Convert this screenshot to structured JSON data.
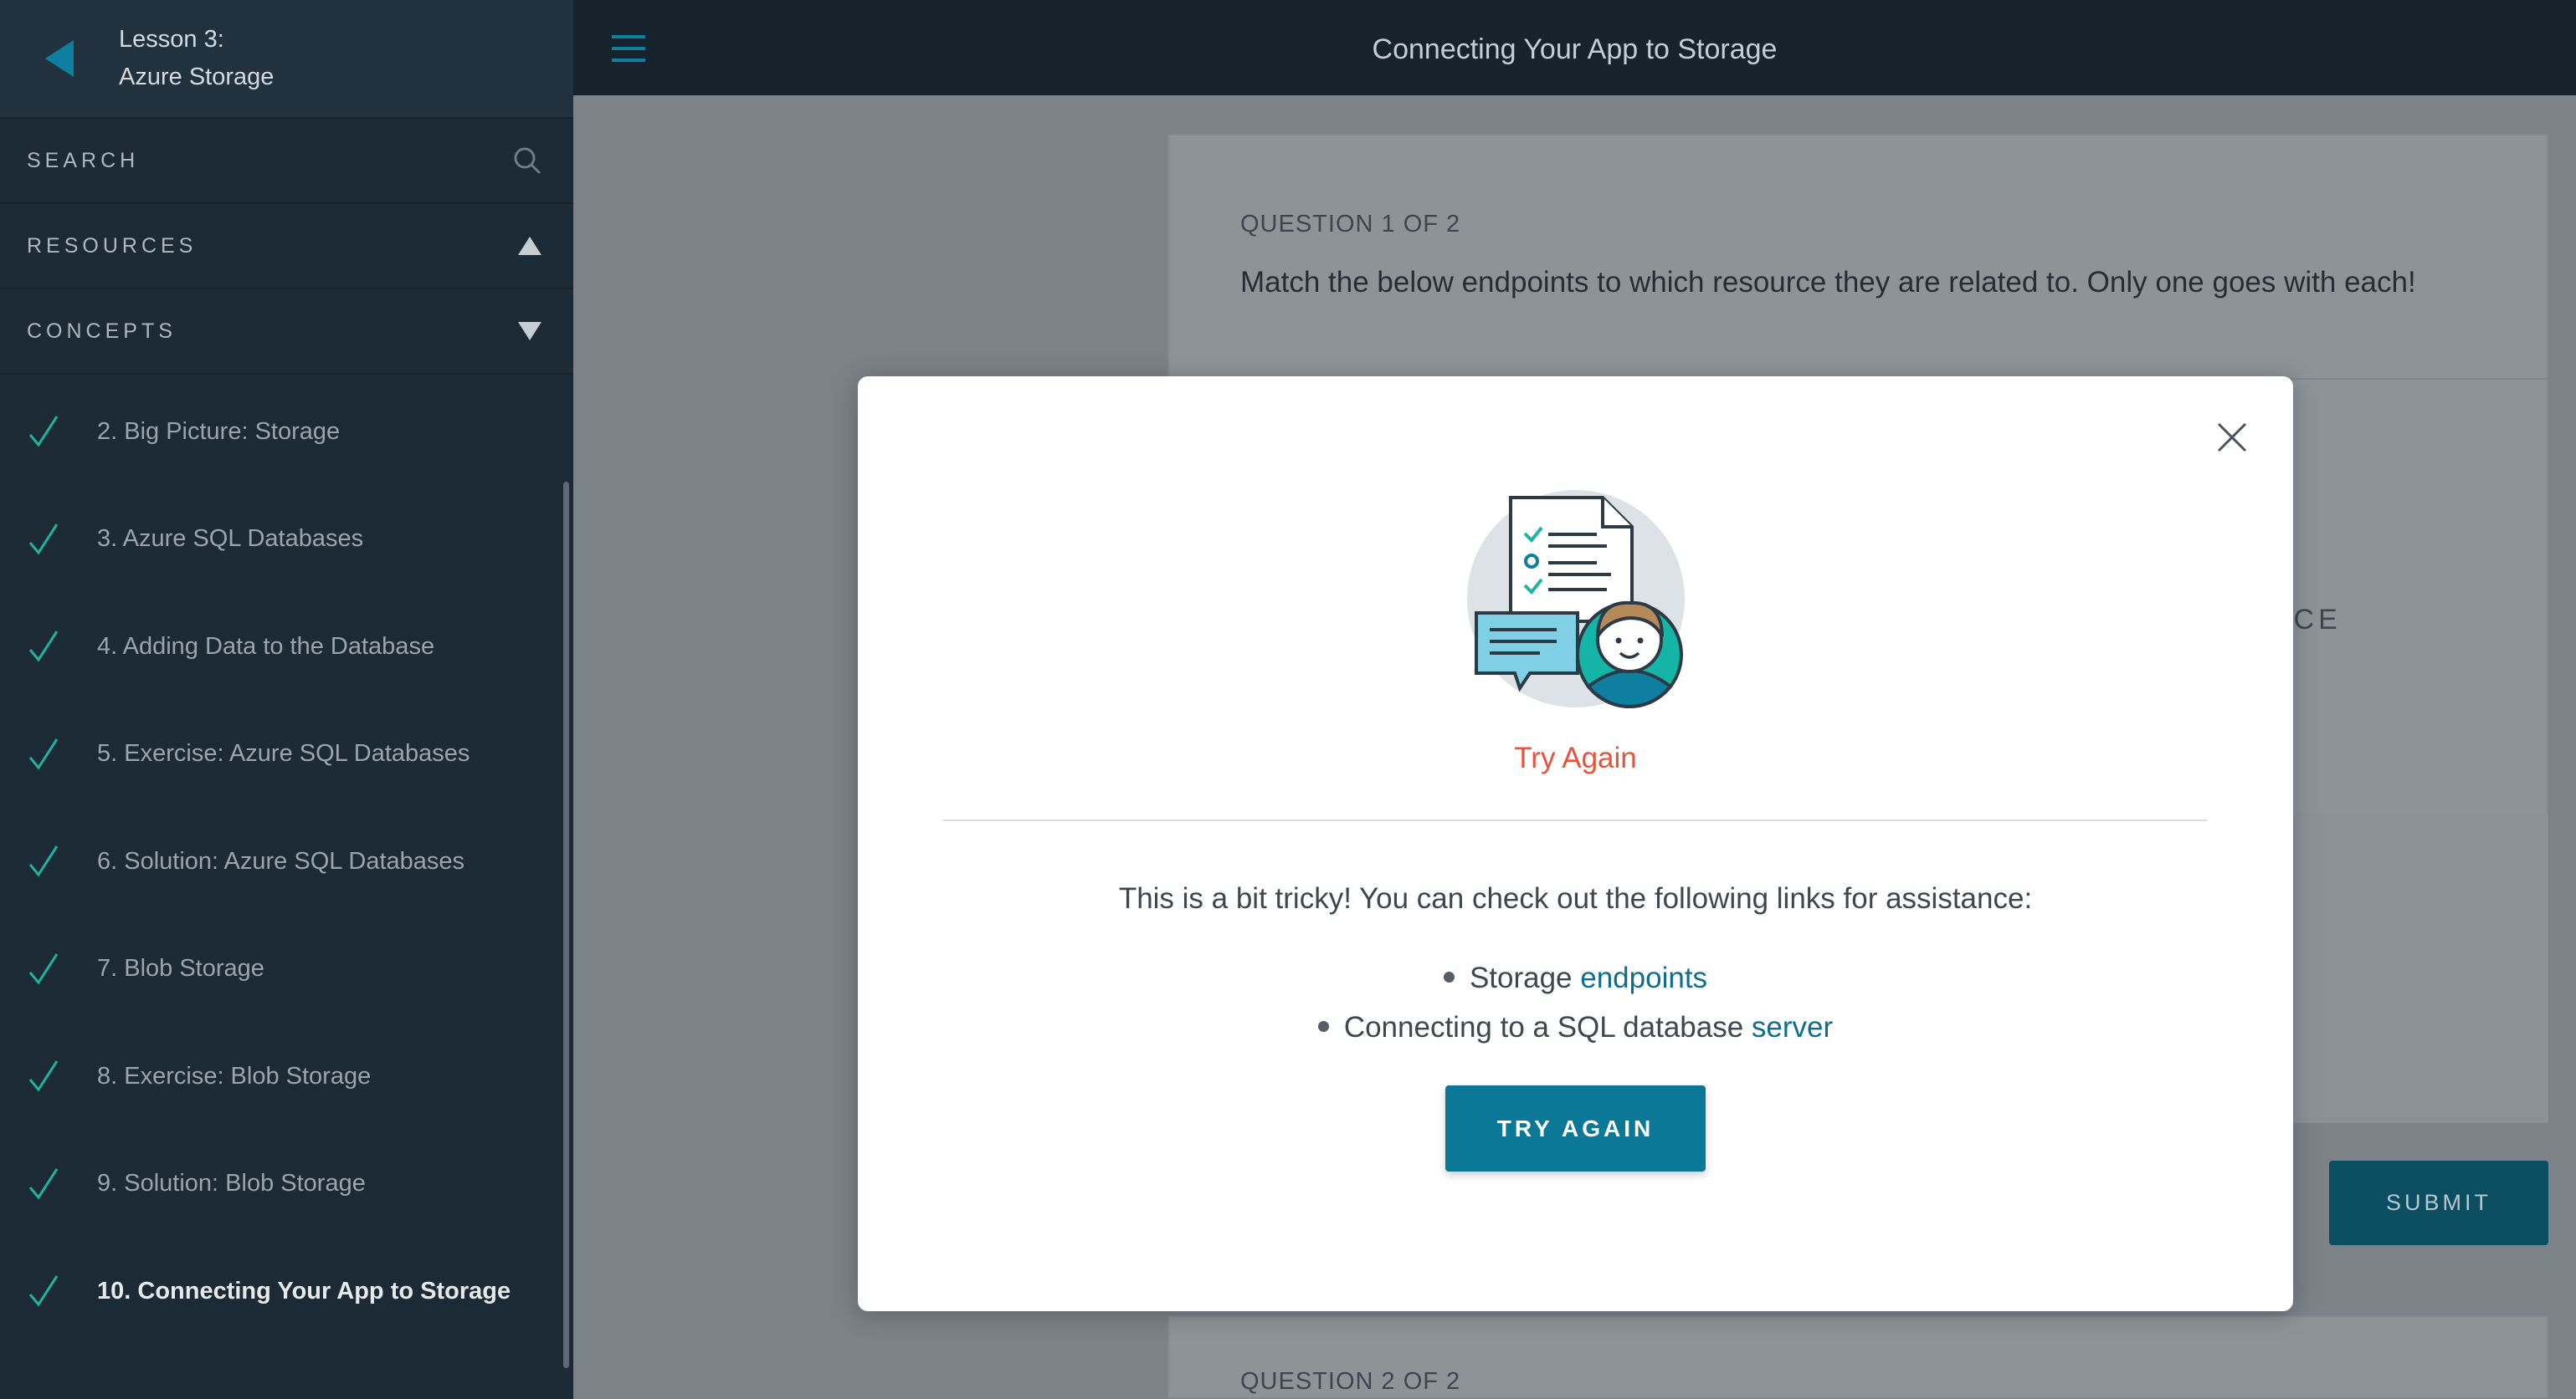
{
  "sidebar": {
    "lesson_number": "Lesson 3:",
    "lesson_title": "Azure Storage",
    "search_label": "SEARCH",
    "resources_label": "RESOURCES",
    "concepts_label": "CONCEPTS",
    "concepts": [
      {
        "label": "2. Big Picture: Storage",
        "done": true
      },
      {
        "label": "3. Azure SQL Databases",
        "done": true
      },
      {
        "label": "4. Adding Data to the Database",
        "done": true
      },
      {
        "label": "5. Exercise: Azure SQL Databases",
        "done": true
      },
      {
        "label": "6. Solution: Azure SQL Databases",
        "done": true
      },
      {
        "label": "7. Blob Storage",
        "done": true
      },
      {
        "label": "8. Exercise: Blob Storage",
        "done": true
      },
      {
        "label": "9. Solution: Blob Storage",
        "done": true
      },
      {
        "label": "10. Connecting Your App to Storage",
        "done": true,
        "active": true
      }
    ]
  },
  "header": {
    "title": "Connecting Your App to Storage"
  },
  "quiz": {
    "question_label": "QUESTION 1 OF 2",
    "question_text": "Match the below endpoints to which resource they are related to. Only one goes with each!",
    "column_header_partial": "OURCE",
    "submit_label": "SUBMIT",
    "question2_label": "QUESTION 2 OF 2"
  },
  "modal": {
    "title": "Try Again",
    "message": "This is a bit tricky! You can check out the following links for assistance:",
    "links": [
      {
        "prefix": "Storage ",
        "link_text": "endpoints"
      },
      {
        "prefix": "Connecting to a SQL database ",
        "link_text": "server"
      }
    ],
    "button_label": "TRY AGAIN"
  },
  "colors": {
    "sidebar_bg": "#1c2a36",
    "topbar_bg": "#16232d",
    "accent_teal": "#0b7898",
    "check_green": "#1fb3a0",
    "try_again_red": "#e7533c",
    "link": "#0e6e8c"
  },
  "icons": {
    "back": "back-arrow-icon",
    "search": "search-icon",
    "resources": "triangle-up-icon",
    "concepts": "triangle-down-icon",
    "check": "check-icon",
    "menu": "hamburger-menu-icon",
    "close": "close-icon"
  }
}
